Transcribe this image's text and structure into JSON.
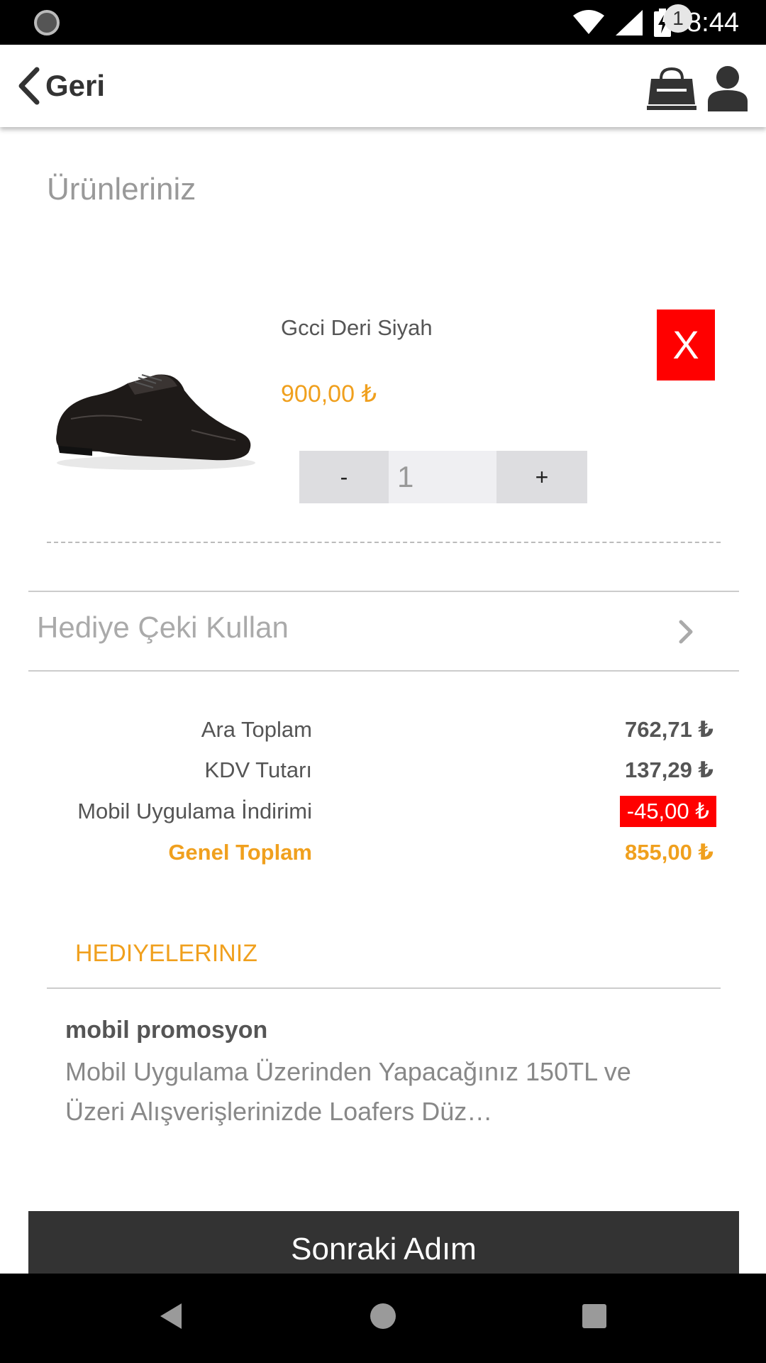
{
  "status_bar": {
    "time": "8:44"
  },
  "header": {
    "back_label": "Geri",
    "cart_count": "1"
  },
  "cart": {
    "section_title": "Ürünleriniz",
    "item": {
      "name": "Gcci Deri Siyah",
      "price": "900,00 ₺",
      "quantity": "1",
      "remove_label": "X",
      "minus_label": "-",
      "plus_label": "+"
    }
  },
  "gift_voucher": {
    "label": "Hediye Çeki Kullan"
  },
  "summary": {
    "subtotal_label": "Ara Toplam",
    "subtotal_value": "762,71 ₺",
    "vat_label": "KDV Tutarı",
    "vat_value": "137,29 ₺",
    "discount_label": "Mobil Uygulama İndirimi",
    "discount_value": "-45,00 ₺",
    "total_label": "Genel Toplam",
    "total_value": "855,00 ₺"
  },
  "gifts": {
    "title": "HEDIYELERINIZ",
    "promo_title": "mobil promosyon",
    "promo_description": "Mobil Uygulama Üzerinden Yapacağınız 150TL ve Üzeri Alışverişlerinizde Loafers Düz…"
  },
  "next_button": {
    "label": "Sonraki Adım"
  },
  "colors": {
    "accent_orange": "#f0a01e",
    "remove_red": "#ff0000",
    "button_dark": "#333333"
  },
  "icons": {
    "back": "chevron-left-icon",
    "cart": "shopping-bag-icon",
    "user": "user-icon",
    "gift_row": "chevron-right-icon"
  }
}
